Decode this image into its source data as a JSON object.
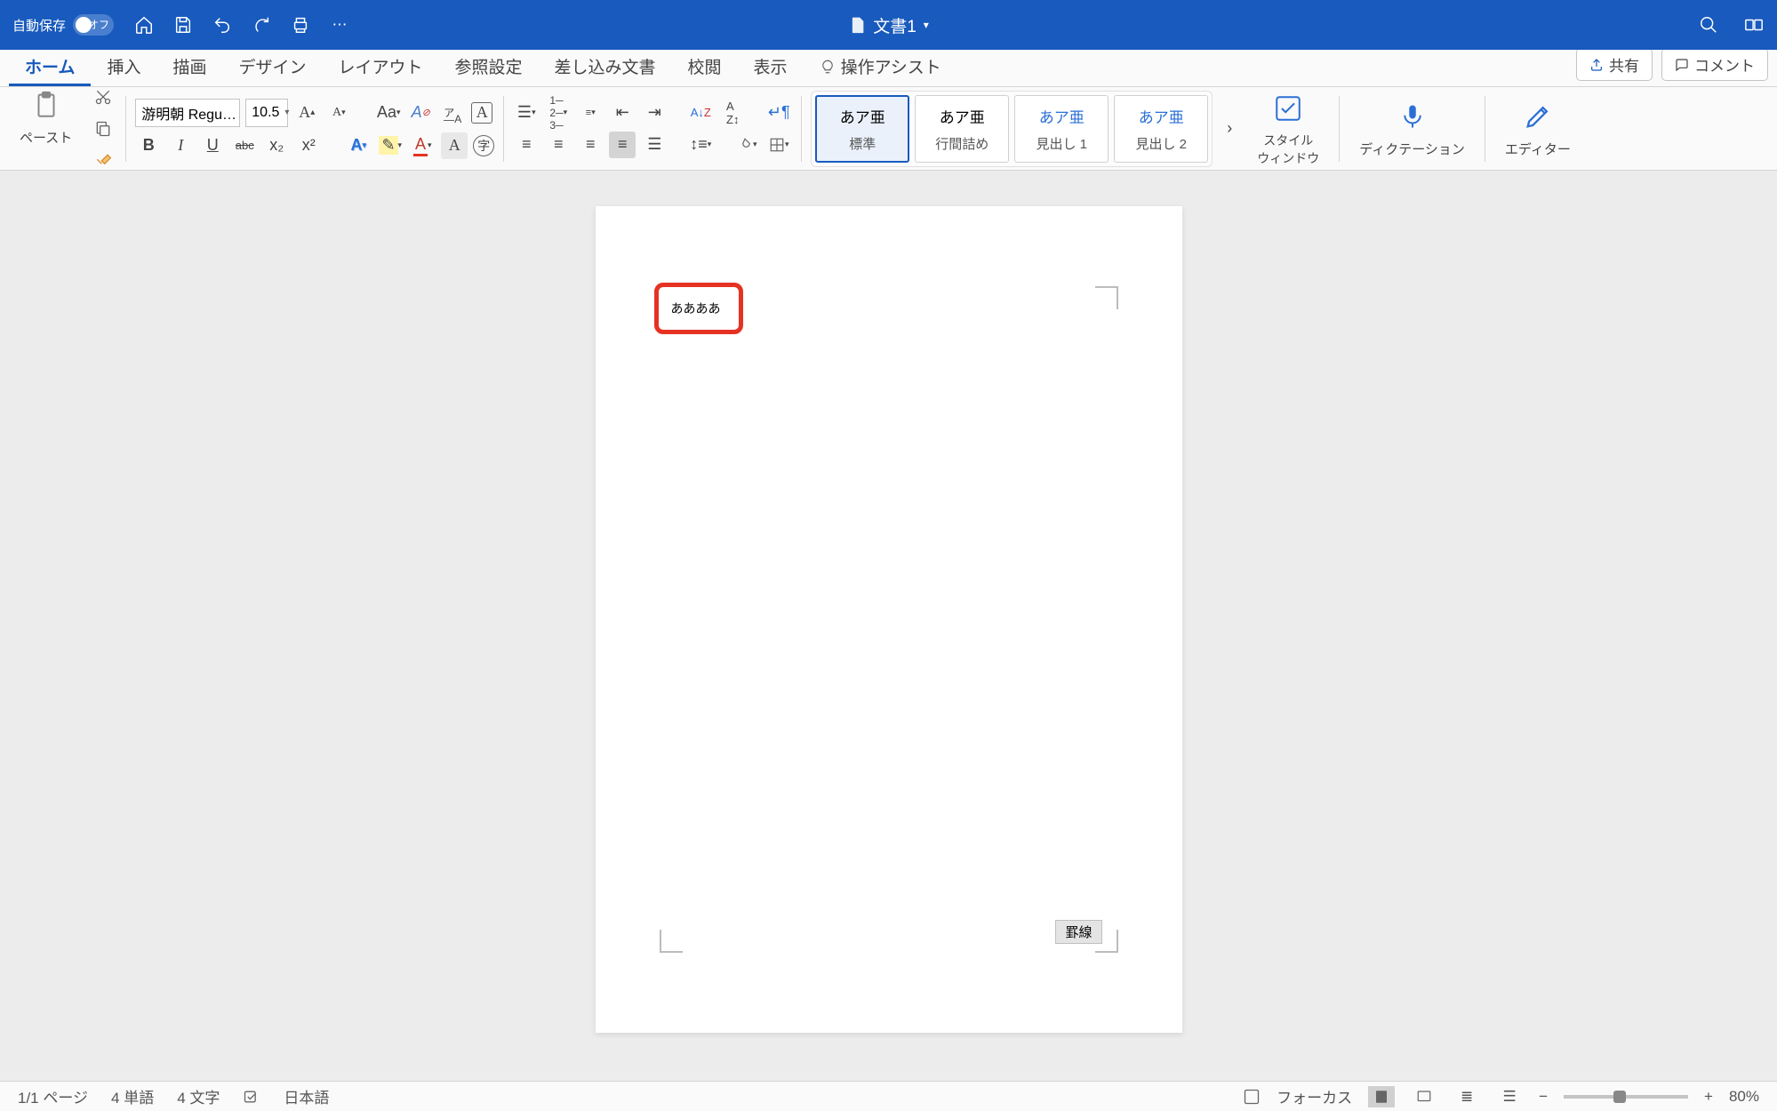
{
  "titlebar": {
    "autosave_label": "自動保存",
    "autosave_state": "オフ",
    "doc_title": "文書1"
  },
  "tabs": {
    "items": [
      "ホーム",
      "挿入",
      "描画",
      "デザイン",
      "レイアウト",
      "参照設定",
      "差し込み文書",
      "校閲",
      "表示"
    ],
    "tell_me": "操作アシスト",
    "share": "共有",
    "comment": "コメント"
  },
  "ribbon": {
    "paste": "ペースト",
    "font_name": "游明朝 Regu…",
    "font_size": "10.5",
    "case": "Aa",
    "bold": "B",
    "italic": "I",
    "underline": "U",
    "strike": "abc",
    "sub": "x₂",
    "sup": "x²",
    "styles": [
      {
        "sample": "あア亜",
        "label": "標準"
      },
      {
        "sample": "あア亜",
        "label": "行間詰め"
      },
      {
        "sample": "あア亜",
        "label": "見出し 1"
      },
      {
        "sample": "あア亜",
        "label": "見出し 2"
      }
    ],
    "style_pane_label": "スタイル\nウィンドウ",
    "dictation": "ディクテーション",
    "editor": "エディター"
  },
  "document": {
    "text": "ああああ",
    "tooltip": "罫線"
  },
  "statusbar": {
    "page": "1/1 ページ",
    "words": "4 単語",
    "chars": "4 文字",
    "lang": "日本語",
    "focus": "フォーカス",
    "zoom": "80%"
  }
}
